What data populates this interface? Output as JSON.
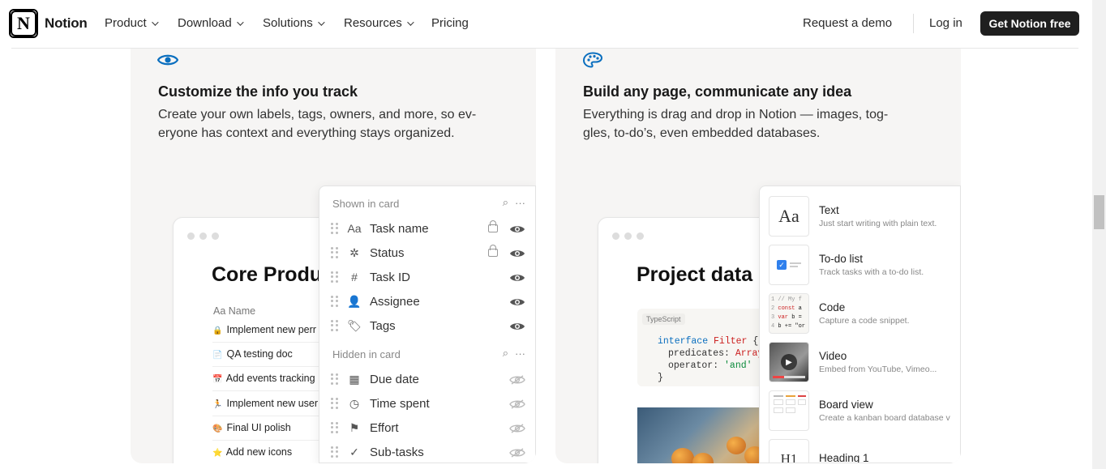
{
  "nav": {
    "brand": "Notion",
    "logo_letter": "N",
    "items": [
      "Product",
      "Download",
      "Solutions",
      "Resources"
    ],
    "pricing": "Pricing",
    "request_demo": "Request a demo",
    "login": "Log in",
    "cta": "Get Notion free"
  },
  "left_card": {
    "icon": "eye-icon",
    "title": "Customize the info you track",
    "desc_line1": "Create your own labels, tags, owners, and more, so ev-",
    "desc_line2": "eryone has context and everything stays organized.",
    "mock_title": "Core Produ",
    "table_head": "Aa  Name",
    "rows": [
      {
        "icon": "🔒",
        "label": "Implement new perr"
      },
      {
        "icon": "📄",
        "label": "QA testing doc"
      },
      {
        "icon": "📅",
        "label": "Add events tracking"
      },
      {
        "icon": "🏃",
        "label": "Implement new user"
      },
      {
        "icon": "🎨",
        "label": "Final UI polish"
      },
      {
        "icon": "⭐",
        "label": "Add new icons"
      }
    ],
    "panel": {
      "shown_label": "Shown in card",
      "hidden_label": "Hidden in card",
      "shown": [
        {
          "icon": "Aa",
          "label": "Task name",
          "locked": true
        },
        {
          "icon": "✲",
          "label": "Status",
          "locked": true
        },
        {
          "icon": "#",
          "label": "Task ID",
          "locked": false
        },
        {
          "icon": "👤",
          "label": "Assignee",
          "locked": false
        },
        {
          "icon": "🏷",
          "label": "Tags",
          "locked": false
        }
      ],
      "hidden": [
        {
          "icon": "▦",
          "label": "Due date"
        },
        {
          "icon": "◷",
          "label": "Time spent"
        },
        {
          "icon": "⚑",
          "label": "Effort"
        },
        {
          "icon": "✓",
          "label": "Sub-tasks"
        }
      ]
    }
  },
  "right_card": {
    "icon": "palette-icon",
    "title": "Build any page, communicate any idea",
    "desc_line1": "Everything is drag and drop in Notion — images, tog-",
    "desc_line2": "gles, to-do’s, even embedded databases.",
    "mock_title": "Project data",
    "code_tag": "TypeScript",
    "code_lines": [
      "interface Filter {",
      "  predicates: Array",
      "  operator: 'and' |",
      "}"
    ],
    "menu": [
      {
        "name": "Text",
        "sub": "Just start writing with plain text.",
        "thumb": "Aa"
      },
      {
        "name": "To-do list",
        "sub": "Track tasks with a to-do list.",
        "thumb": "todo"
      },
      {
        "name": "Code",
        "sub": "Capture a code snippet.",
        "thumb": "code"
      },
      {
        "name": "Video",
        "sub": "Embed from YouTube, Vimeo...",
        "thumb": "video"
      },
      {
        "name": "Board view",
        "sub": "Create a kanban board database v",
        "thumb": "board"
      },
      {
        "name": "Heading 1",
        "sub": "",
        "thumb": "H1"
      }
    ]
  },
  "colors": {
    "accent": "#0b6fbf",
    "cta_bg": "#1f1f1f"
  }
}
